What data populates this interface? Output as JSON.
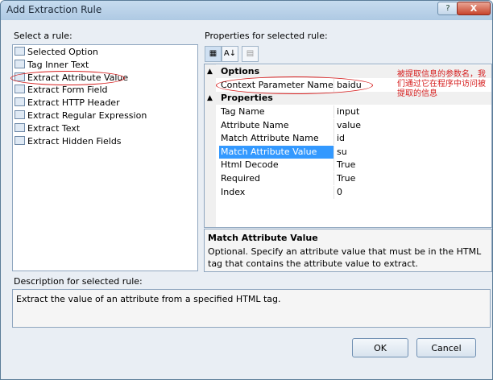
{
  "window": {
    "title": "Add Extraction Rule",
    "help_glyph": "?",
    "close_glyph": "X"
  },
  "left": {
    "label": "Select a rule:",
    "rules": [
      {
        "label": "Selected Option",
        "icon": "rule-icon"
      },
      {
        "label": "Tag Inner Text",
        "icon": "rule-icon"
      },
      {
        "label": "Extract Attribute Value",
        "icon": "rule-icon"
      },
      {
        "label": "Extract Form Field",
        "icon": "rule-icon"
      },
      {
        "label": "Extract HTTP Header",
        "icon": "rule-icon"
      },
      {
        "label": "Extract Regular Expression",
        "icon": "rule-icon"
      },
      {
        "label": "Extract Text",
        "icon": "rule-icon"
      },
      {
        "label": "Extract Hidden Fields",
        "icon": "rule-icon"
      }
    ]
  },
  "properties": {
    "label": "Properties for selected rule:",
    "toolbar": {
      "categorized_glyph": "▦",
      "alphabetical_glyph": "A↓",
      "pages_glyph": "▤"
    },
    "options_header": "Options",
    "options": [
      {
        "name": "Context Parameter Name",
        "value": "baidu"
      }
    ],
    "properties_header": "Properties",
    "props": [
      {
        "name": "Tag Name",
        "value": "input"
      },
      {
        "name": "Attribute Name",
        "value": "value"
      },
      {
        "name": "Match Attribute Name",
        "value": "id"
      },
      {
        "name": "Match Attribute Value",
        "value": "su"
      },
      {
        "name": "Html Decode",
        "value": "True"
      },
      {
        "name": "Required",
        "value": "True"
      },
      {
        "name": "Index",
        "value": "0"
      }
    ],
    "collapse_glyph": "▲",
    "description_title": "Match Attribute Value",
    "description_text": "Optional. Specify an attribute value that must be in the HTML tag that contains the attribute value to extract."
  },
  "annotation": {
    "text": "被提取信息的参数名，我们通过它在程序中访问被提取的信息",
    "color": "#d61f1f"
  },
  "description": {
    "label": "Description for selected rule:",
    "text": "Extract the value of an attribute from a specified HTML tag."
  },
  "buttons": {
    "ok": "OK",
    "cancel": "Cancel"
  }
}
